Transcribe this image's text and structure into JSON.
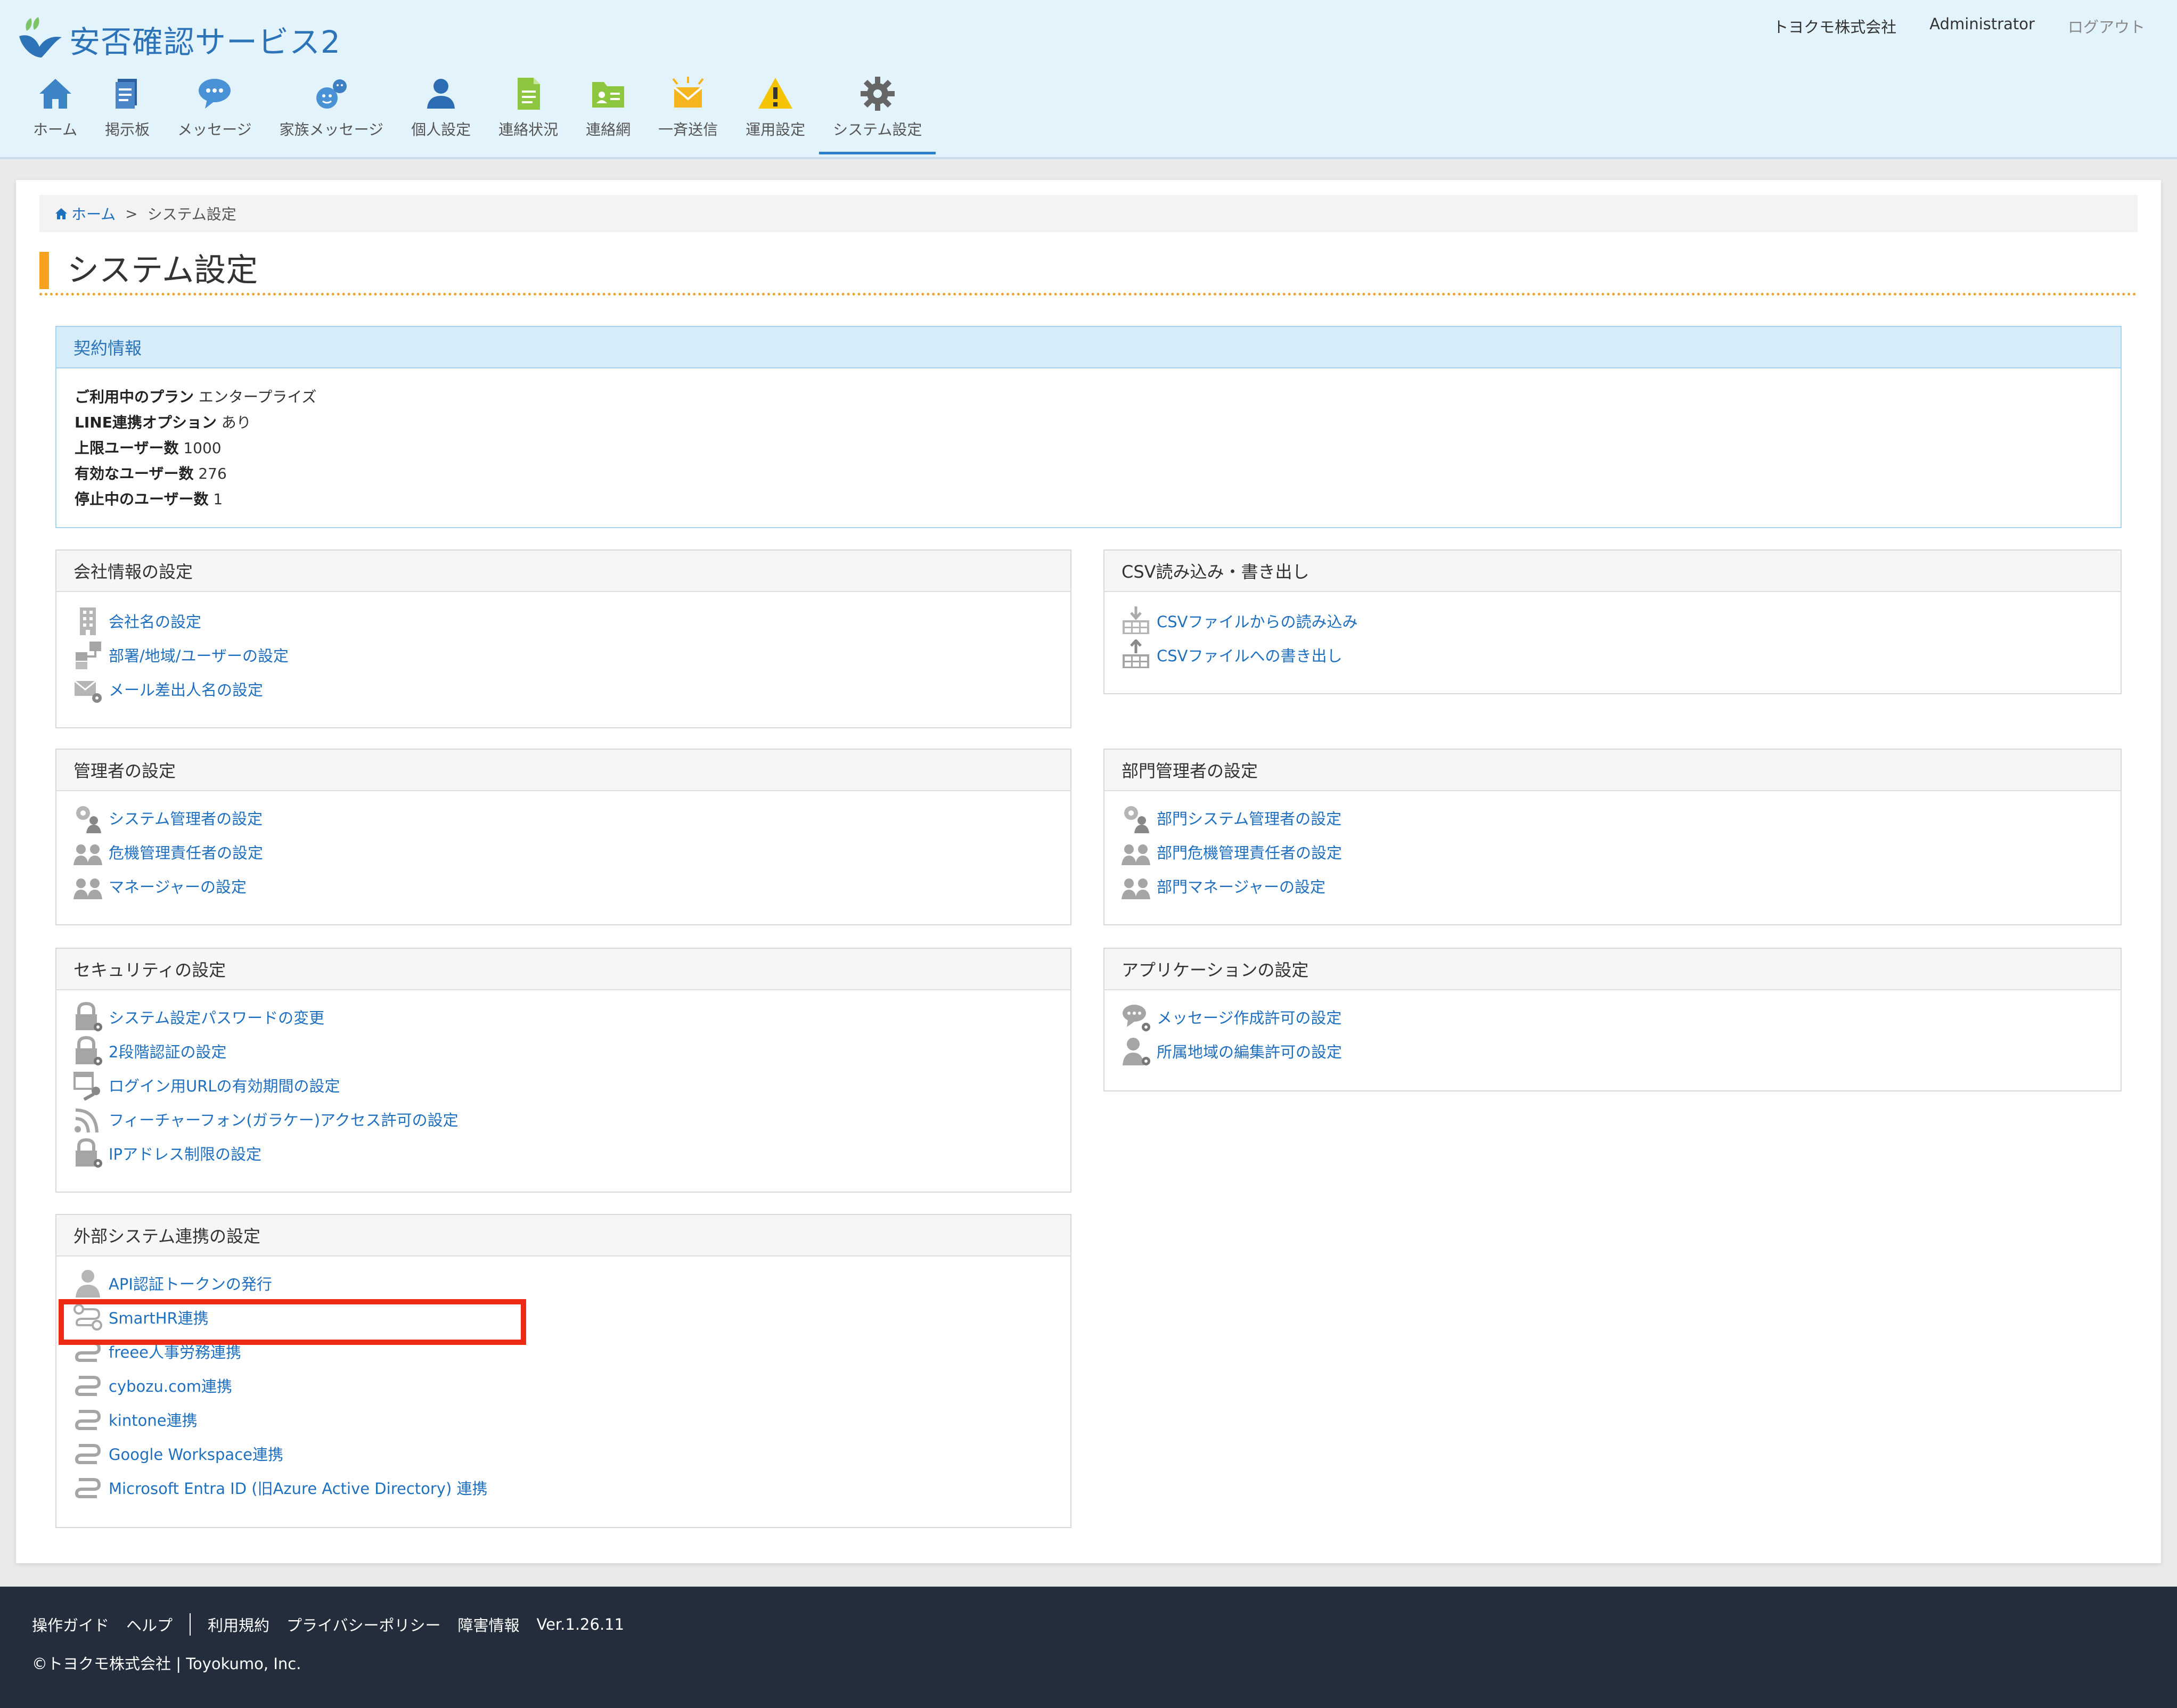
{
  "app": {
    "title": "安否確認サービス2"
  },
  "header": {
    "company": "トヨクモ株式会社",
    "user": "Administrator",
    "logout": "ログアウト"
  },
  "nav": [
    "ホーム",
    "掲示板",
    "メッセージ",
    "家族メッセージ",
    "個人設定",
    "連絡状況",
    "連絡網",
    "一斉送信",
    "運用設定",
    "システム設定"
  ],
  "breadcrumb": {
    "home": "ホーム",
    "sep": ">",
    "current": "システム設定"
  },
  "page_title": "システム設定",
  "contract": {
    "title": "契約情報",
    "rows": [
      {
        "label": "ご利用中のプラン",
        "value": "エンタープライズ"
      },
      {
        "label": "LINE連携オプション",
        "value": "あり"
      },
      {
        "label": "上限ユーザー数",
        "value": "1000"
      },
      {
        "label": "有効なユーザー数",
        "value": "276"
      },
      {
        "label": "停止中のユーザー数",
        "value": "1"
      }
    ]
  },
  "sections": {
    "company": {
      "title": "会社情報の設定",
      "items": [
        "会社名の設定",
        "部署/地域/ユーザーの設定",
        "メール差出人名の設定"
      ]
    },
    "csv": {
      "title": "CSV読み込み・書き出し",
      "items": [
        "CSVファイルからの読み込み",
        "CSVファイルへの書き出し"
      ]
    },
    "admin": {
      "title": "管理者の設定",
      "items": [
        "システム管理者の設定",
        "危機管理責任者の設定",
        "マネージャーの設定"
      ]
    },
    "dept_admin": {
      "title": "部門管理者の設定",
      "items": [
        "部門システム管理者の設定",
        "部門危機管理責任者の設定",
        "部門マネージャーの設定"
      ]
    },
    "security": {
      "title": "セキュリティの設定",
      "items": [
        "システム設定パスワードの変更",
        "2段階認証の設定",
        "ログイン用URLの有効期間の設定",
        "フィーチャーフォン(ガラケー)アクセス許可の設定",
        "IPアドレス制限の設定"
      ]
    },
    "application": {
      "title": "アプリケーションの設定",
      "items": [
        "メッセージ作成許可の設定",
        "所属地域の編集許可の設定"
      ]
    },
    "external": {
      "title": "外部システム連携の設定",
      "items": [
        "API認証トークンの発行",
        "SmartHR連携",
        "freee人事労務連携",
        "cybozu.com連携",
        "kintone連携",
        "Google Workspace連携",
        "Microsoft Entra ID (旧Azure Active Directory) 連携"
      ]
    }
  },
  "footer": {
    "links": [
      "操作ガイド",
      "ヘルプ",
      "利用規約",
      "プライバシーポリシー",
      "障害情報",
      "Ver.1.26.11"
    ],
    "copyright": "©トヨクモ株式会社 | Toyokumo, Inc."
  },
  "colors": {
    "header_bg": "#e3f3fc",
    "link": "#1f6fbf",
    "accent": "#f7a21e",
    "highlight": "#ee2a14",
    "footer_bg": "#242d3b"
  }
}
